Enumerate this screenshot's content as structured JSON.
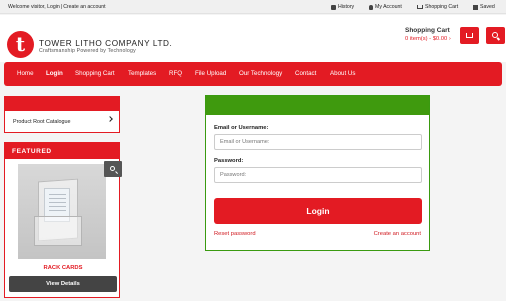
{
  "topbar": {
    "welcome_prefix": "Welcome visitor,",
    "login_link": "Login",
    "separator": "|",
    "create_link": "Create an account",
    "history": "History",
    "my_account": "My Account",
    "shopping_cart": "Shopping Cart",
    "saved": "Saved"
  },
  "header": {
    "logo_letter": "t",
    "company_name": "TOWER LITHO COMPANY LTD.",
    "tagline": "Craftsmanship Powered by Technology",
    "cart_title": "Shopping Cart",
    "cart_summary": "0 item(s) - $0.00 ›"
  },
  "nav": {
    "items": [
      "Home",
      "Login",
      "Shopping Cart",
      "Templates",
      "RFQ",
      "File Upload",
      "Our Technology",
      "Contact",
      "About Us"
    ],
    "active": "Login"
  },
  "sidebar": {
    "catalogue_item": "Product Root Catalogue",
    "featured_title": "FEATURED",
    "product_name": "RACK CARDS",
    "view_details": "View Details"
  },
  "login": {
    "email_label": "Email or Username:",
    "email_placeholder": "Email or Username:",
    "password_label": "Password:",
    "password_placeholder": "Password:",
    "button": "Login",
    "reset_link": "Reset password",
    "create_link": "Create an account"
  },
  "colors": {
    "brand_red": "#e31b23",
    "login_green": "#3f9a0e",
    "dark_button": "#444444"
  }
}
